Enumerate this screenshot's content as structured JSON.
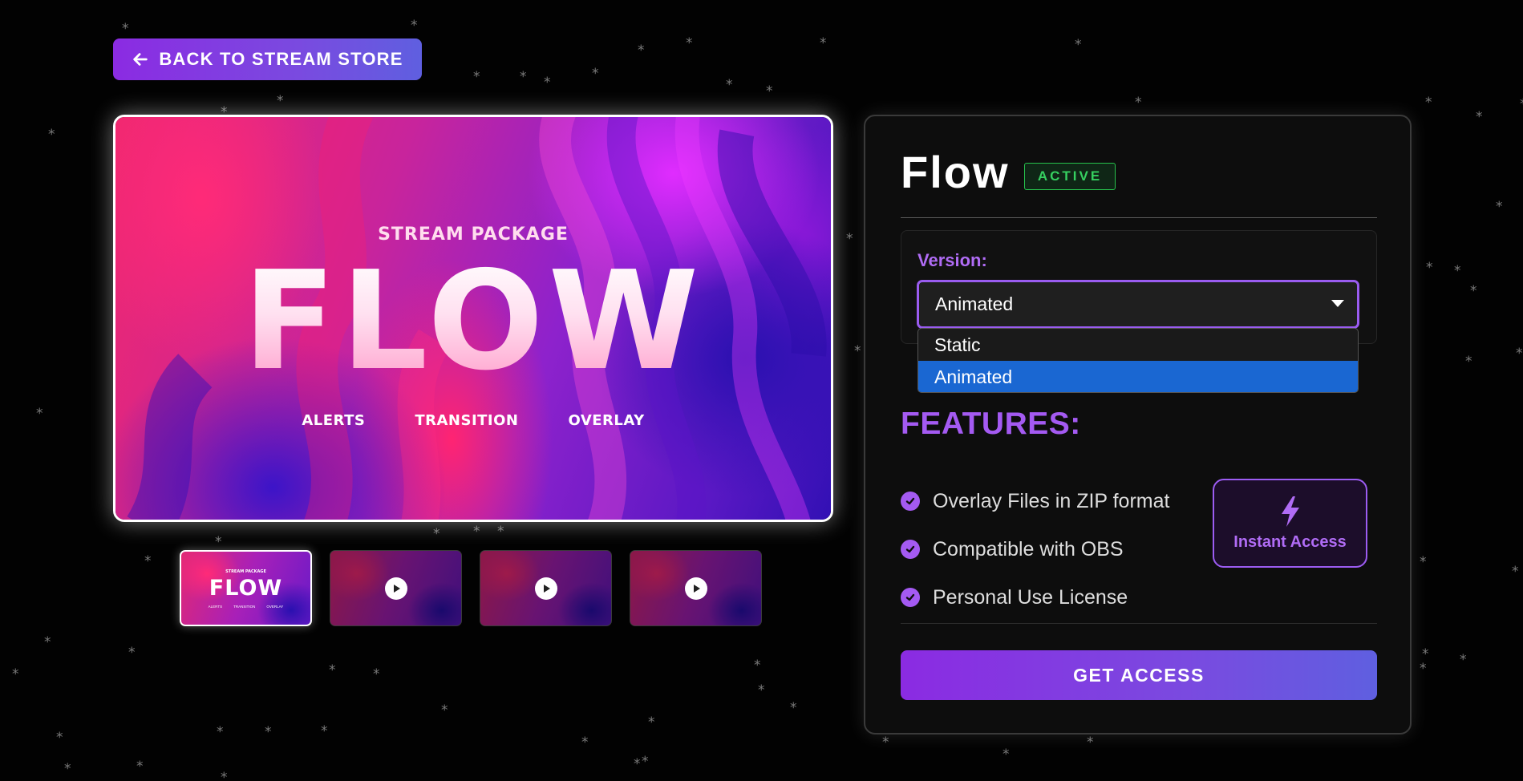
{
  "back_button": {
    "label": "BACK TO STREAM STORE",
    "icon": "arrow-left-icon"
  },
  "preview": {
    "kicker": "STREAM PACKAGE",
    "title": "FLOW",
    "tags": [
      "ALERTS",
      "TRANSITION",
      "OVERLAY"
    ]
  },
  "thumbnails": [
    {
      "kind": "image",
      "active": true,
      "mini_kicker": "STREAM PACKAGE",
      "mini_title": "FLOW",
      "mini_tags": [
        "ALERTS",
        "TRANSITION",
        "OVERLAY"
      ]
    },
    {
      "kind": "video",
      "active": false,
      "icon": "play-icon"
    },
    {
      "kind": "video",
      "active": false,
      "icon": "play-icon"
    },
    {
      "kind": "video",
      "active": false,
      "icon": "play-icon"
    }
  ],
  "product": {
    "title": "Flow",
    "status_badge": "ACTIVE",
    "version_label": "Version:",
    "selected_version": "Animated",
    "version_options": [
      "Static",
      "Animated"
    ],
    "features_title": "FEATURES:",
    "features": [
      "Overlay Files in ZIP format",
      "Compatible with OBS",
      "Personal Use License"
    ],
    "instant_access": {
      "label": "Instant Access",
      "icon": "lightning-icon"
    },
    "cta_label": "GET ACCESS"
  },
  "colors": {
    "accent_purple": "#a45af2",
    "button_gradient_start": "#8b2be2",
    "button_gradient_end": "#5f5fe0",
    "active_green": "#36d060",
    "selected_option_blue": "#1a67d2",
    "background": "#020202"
  }
}
